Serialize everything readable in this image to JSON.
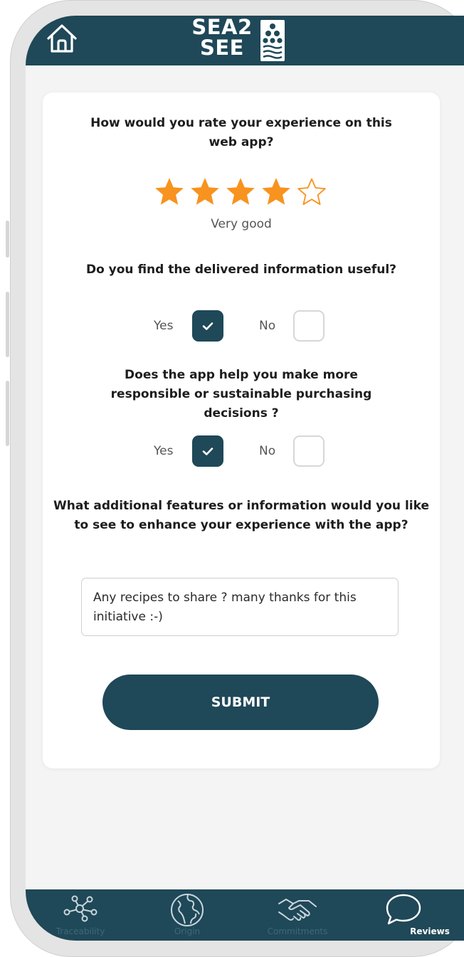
{
  "header": {
    "logo_line1": "SEA2",
    "logo_line2": "SEE"
  },
  "survey": {
    "q1": "How would you rate your experience on this web app?",
    "rating": {
      "value": 4,
      "max": 5,
      "label": "Very good"
    },
    "q2": "Do you find the delivered information useful?",
    "q2_yes_label": "Yes",
    "q2_no_label": "No",
    "q2_answer": "Yes",
    "q3": "Does the app help you make more responsible or sustainable purchasing decisions ?",
    "q3_yes_label": "Yes",
    "q3_no_label": "No",
    "q3_answer": "Yes",
    "q4": "What additional features or information would you like to see to enhance your experience with the app?",
    "answer_text": "Any recipes to share ? many thanks for this initiative :-)",
    "submit_label": "SUBMIT"
  },
  "nav": {
    "items": [
      {
        "label": "Traceability",
        "icon": "network-icon"
      },
      {
        "label": "Origin",
        "icon": "globe-icon"
      },
      {
        "label": "Commitments",
        "icon": "handshake-icon"
      },
      {
        "label": "Reviews",
        "icon": "chat-bubble-icon",
        "active": true
      }
    ]
  },
  "colors": {
    "primary": "#1f4858",
    "star": "#f7931e",
    "background": "#f4f4f4"
  }
}
